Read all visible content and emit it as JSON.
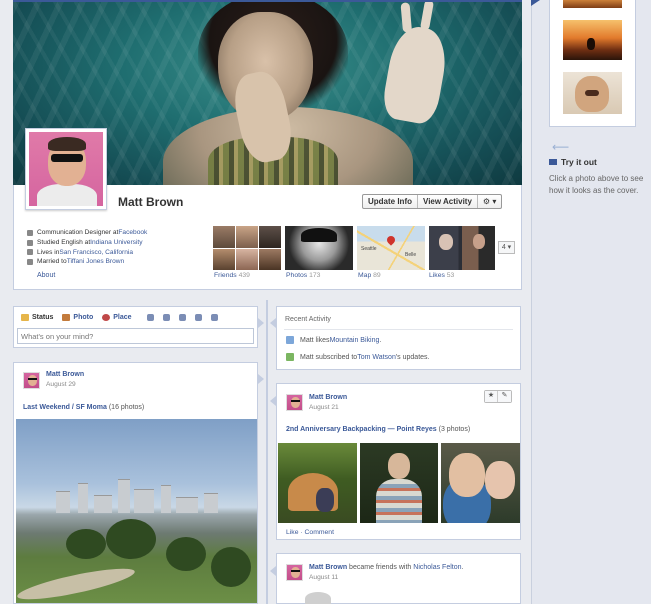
{
  "profile": {
    "name": "Matt Brown",
    "buttons": {
      "update_info": "Update Info",
      "view_activity": "View Activity",
      "settings": "⚙ ▾"
    },
    "about": [
      {
        "text": "Communication Designer at ",
        "link": "Facebook"
      },
      {
        "text": "Studied English at ",
        "link": "Indiana University"
      },
      {
        "text": "Lives in ",
        "link": "San Francisco, California"
      },
      {
        "text": "Married to ",
        "link": "Tiffani Jones Brown"
      }
    ],
    "about_link": "About",
    "tiles": [
      {
        "label": "Friends",
        "count": "439"
      },
      {
        "label": "Photos",
        "count": "173"
      },
      {
        "label": "Map",
        "count": "89"
      },
      {
        "label": "Likes",
        "count": "53"
      }
    ],
    "map_labels": [
      "Seattle",
      "Belle"
    ],
    "more": "4 ▾"
  },
  "composer": {
    "tabs": [
      "Status",
      "Photo",
      "Place"
    ],
    "placeholder": "What's on your mind?"
  },
  "recent_activity": {
    "title": "Recent Activity",
    "items": [
      {
        "prefix": "Matt likes ",
        "link": "Mountain Biking",
        "suffix": "."
      },
      {
        "prefix": "Matt subscribed to ",
        "link": "Tom Watson",
        "suffix": "'s updates."
      }
    ]
  },
  "posts": {
    "left": {
      "author": "Matt Brown",
      "date": "August 29",
      "title": "Last Weekend / SF Moma",
      "count": "(16 photos)"
    },
    "right": {
      "author": "Matt Brown",
      "date": "August 21",
      "title": "2nd Anniversary Backpacking — Point Reyes",
      "count": "(3 photos)",
      "tools": [
        "★",
        "✎"
      ],
      "actions": "Like · Comment"
    },
    "right2": {
      "author": "Matt Brown",
      "text": " became friends with ",
      "friend": "Nicholas Felton",
      "suffix": ".",
      "date": "August 11"
    }
  },
  "cover_chooser": {
    "try_title": "Try it out",
    "try_text": "Click a photo above to see how it looks as the cover."
  },
  "colors": {
    "link": "#3b5998",
    "border": "#c4cde0",
    "background": "#e9ebf0"
  }
}
